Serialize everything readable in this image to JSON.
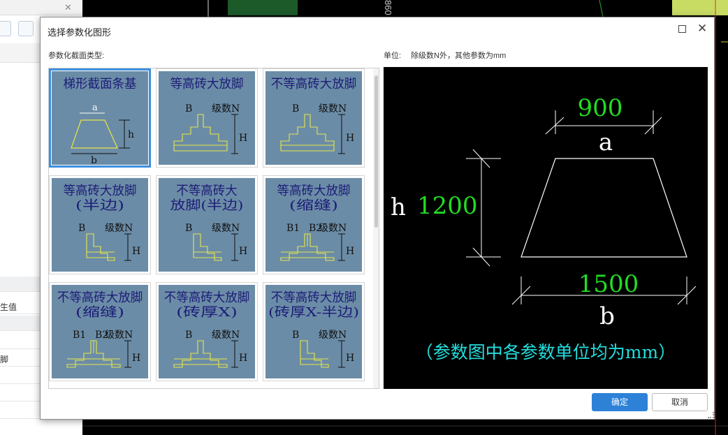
{
  "background": {
    "vertical_text": "860",
    "left_panel": {
      "rows": [
        "生值",
        "脚"
      ]
    }
  },
  "dialog": {
    "title": "选择参数化图形",
    "section_label": "参数化截面类型:",
    "unit_label": "单位:",
    "unit_text": "除级数N外，其他参数为mm",
    "ok_label": "确定",
    "cancel_label": "取消"
  },
  "shapes": [
    {
      "title_lines": [
        "梯形截面条基"
      ],
      "kind": "trapezoid",
      "params": [
        "a",
        "h",
        "b"
      ],
      "selected": true
    },
    {
      "title_lines": [
        "等高砖大放脚"
      ],
      "kind": "step",
      "params": [
        "B",
        "级数N",
        "H"
      ],
      "selected": false
    },
    {
      "title_lines": [
        "不等高砖大放脚"
      ],
      "kind": "step",
      "params": [
        "B",
        "级数N",
        "H"
      ],
      "selected": false
    },
    {
      "title_lines": [
        "等高砖大放脚",
        "(半边)"
      ],
      "kind": "half",
      "params": [
        "B",
        "级数N",
        "H"
      ],
      "selected": false
    },
    {
      "title_lines": [
        "不等高砖大",
        "放脚(半边)"
      ],
      "kind": "half",
      "params": [
        "B",
        "级数N",
        "H"
      ],
      "selected": false
    },
    {
      "title_lines": [
        "等高砖大放脚",
        "(缩缝)"
      ],
      "kind": "gap",
      "params": [
        "B1",
        "B2",
        "级数N",
        "H"
      ],
      "selected": false
    },
    {
      "title_lines": [
        "不等高砖大放脚",
        "(缩缝)"
      ],
      "kind": "gap",
      "params": [
        "B1",
        "B2",
        "级数N",
        "H"
      ],
      "selected": false
    },
    {
      "title_lines": [
        "不等高砖大放脚",
        "(砖厚X)"
      ],
      "kind": "step",
      "params": [
        "B",
        "级数N",
        "H"
      ],
      "selected": false
    },
    {
      "title_lines": [
        "不等高砖大放脚",
        "(砖厚X-半边)"
      ],
      "kind": "half",
      "params": [
        "B",
        "级数N",
        "H"
      ],
      "selected": false
    }
  ],
  "preview": {
    "top_value": "900",
    "top_param": "a",
    "height_value": "1200",
    "height_param": "h",
    "bottom_value": "1500",
    "bottom_param": "b",
    "note": "（参数图中各参数单位均为mm）",
    "value_color": "#22dd22",
    "param_color": "#ffffff",
    "note_color": "#22dddd"
  },
  "colors": {
    "thumb_bg": "#6b8ca6",
    "thumb_title": "#1c1c78",
    "thumb_line": "#e6e64a",
    "accent": "#2d82d8"
  }
}
